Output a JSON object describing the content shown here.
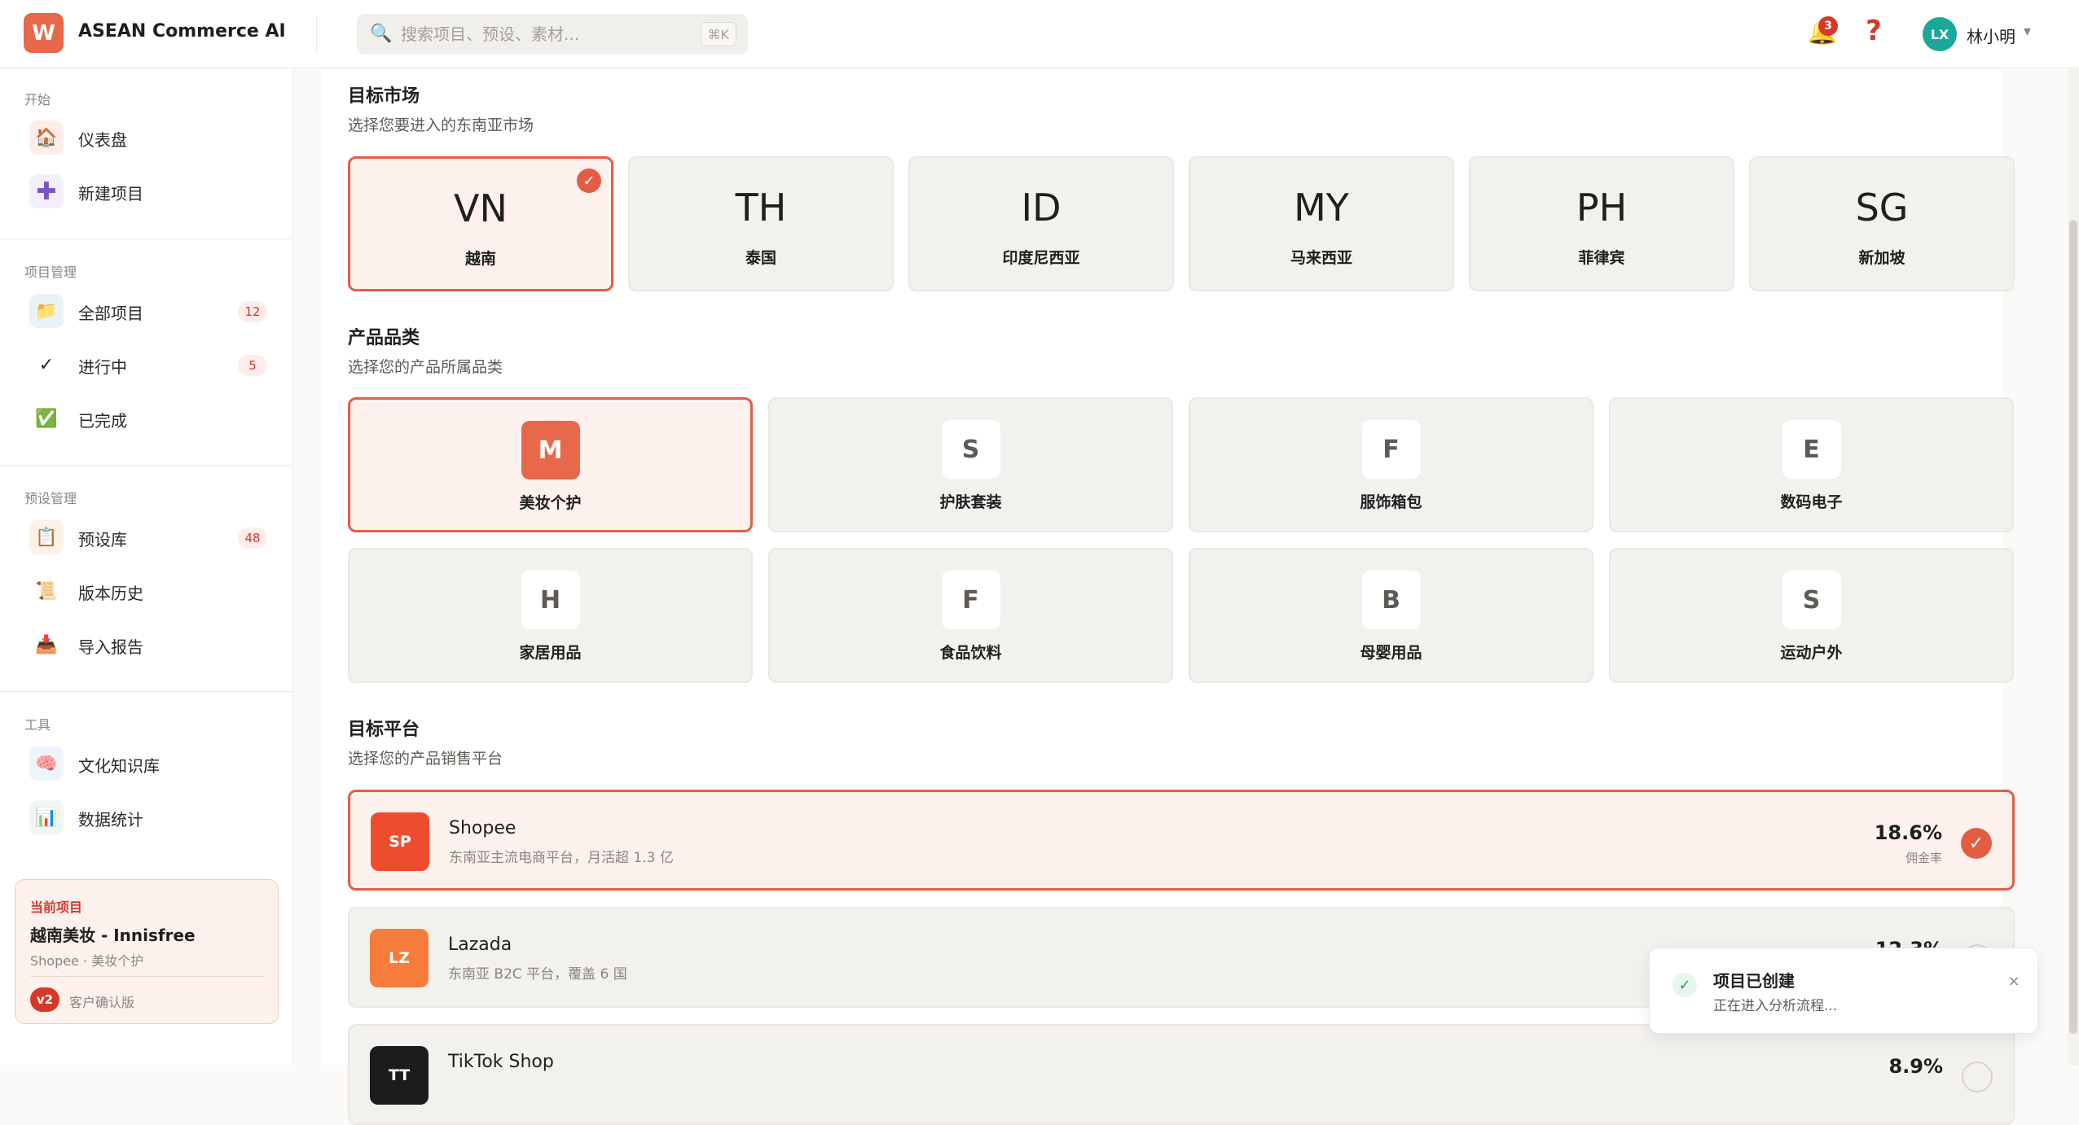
{
  "app": {
    "logo_letter": "W",
    "title": "ASEAN Commerce AI"
  },
  "search": {
    "placeholder": "搜索项目、预设、素材...",
    "shortcut": "⌘K"
  },
  "header": {
    "notification_count": "3",
    "help_glyph": "?",
    "user_initials": "LX",
    "user_name": "林小明",
    "chevron": "▾"
  },
  "sidebar": {
    "sections": [
      {
        "title": "开始",
        "items": [
          {
            "label": "仪表盘",
            "icon": "house-icon",
            "glyph": "🏠",
            "badge": ""
          },
          {
            "label": "新建项目",
            "icon": "plus-icon",
            "glyph": "✚",
            "badge": ""
          }
        ]
      },
      {
        "title": "项目管理",
        "items": [
          {
            "label": "全部项目",
            "icon": "folder-icon",
            "glyph": "📁",
            "badge": "12"
          },
          {
            "label": "进行中",
            "icon": "check-icon",
            "glyph": "✓",
            "badge": "5"
          },
          {
            "label": "已完成",
            "icon": "checkbox-icon",
            "glyph": "✅",
            "badge": ""
          }
        ]
      },
      {
        "title": "预设管理",
        "items": [
          {
            "label": "预设库",
            "icon": "clipboard-icon",
            "glyph": "📋",
            "badge": "48"
          },
          {
            "label": "版本历史",
            "icon": "scroll-icon",
            "glyph": "📜",
            "badge": ""
          },
          {
            "label": "导入报告",
            "icon": "inbox-icon",
            "glyph": "📥",
            "badge": ""
          }
        ]
      },
      {
        "title": "工具",
        "items": [
          {
            "label": "文化知识库",
            "icon": "brain-icon",
            "glyph": "🧠",
            "badge": ""
          },
          {
            "label": "数据统计",
            "icon": "bar-chart-icon",
            "glyph": "📊",
            "badge": ""
          }
        ]
      }
    ],
    "current_project": {
      "label": "当前项目",
      "title": "越南美妆 - Innisfree",
      "subtitle": "Shopee · 美妆个护",
      "version": "v2",
      "status": "客户确认版"
    }
  },
  "target_market": {
    "title": "目标市场",
    "subtitle": "选择您要进入的东南亚市场",
    "options": [
      {
        "code": "VN",
        "name": "越南",
        "selected": true
      },
      {
        "code": "TH",
        "name": "泰国",
        "selected": false
      },
      {
        "code": "ID",
        "name": "印度尼西亚",
        "selected": false
      },
      {
        "code": "MY",
        "name": "马来西亚",
        "selected": false
      },
      {
        "code": "PH",
        "name": "菲律宾",
        "selected": false
      },
      {
        "code": "SG",
        "name": "新加坡",
        "selected": false
      }
    ]
  },
  "product_category": {
    "title": "产品品类",
    "subtitle": "选择您的产品所属品类",
    "options": [
      {
        "letter": "M",
        "name": "美妆个护",
        "selected": true
      },
      {
        "letter": "S",
        "name": "护肤套装",
        "selected": false
      },
      {
        "letter": "F",
        "name": "服饰箱包",
        "selected": false
      },
      {
        "letter": "E",
        "name": "数码电子",
        "selected": false
      },
      {
        "letter": "H",
        "name": "家居用品",
        "selected": false
      },
      {
        "letter": "F",
        "name": "食品饮料",
        "selected": false
      },
      {
        "letter": "B",
        "name": "母婴用品",
        "selected": false
      },
      {
        "letter": "S",
        "name": "运动户外",
        "selected": false
      }
    ]
  },
  "target_platform": {
    "title": "目标平台",
    "subtitle": "选择您的产品销售平台",
    "options": [
      {
        "abbr": "SP",
        "name": "Shopee",
        "desc": "东南亚主流电商平台，月活超 1.3 亿",
        "rate": "18.6%",
        "rate_label": "佣金率",
        "color": "#ee4d2d",
        "selected": true
      },
      {
        "abbr": "LZ",
        "name": "Lazada",
        "desc": "东南亚 B2C 平台，覆盖 6 国",
        "rate": "12.3%",
        "rate_label": "佣金率",
        "color": "#f57c3a",
        "selected": false
      },
      {
        "abbr": "TT",
        "name": "TikTok Shop",
        "desc": "",
        "rate": "8.9%",
        "rate_label": "",
        "color": "#1c1c1c",
        "selected": false
      }
    ]
  },
  "toast": {
    "title": "项目已创建",
    "message": "正在进入分析流程...",
    "close": "×",
    "icon_glyph": "✓"
  },
  "colors": {
    "accent": "#e35d45",
    "brand": "#e7684a",
    "success": "#22a25a"
  }
}
